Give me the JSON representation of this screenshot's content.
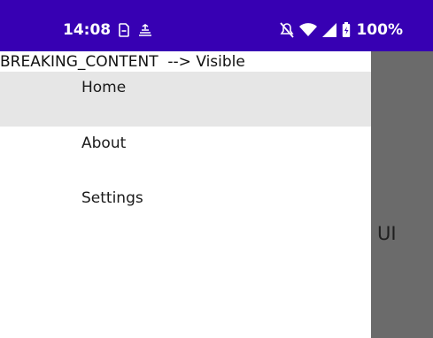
{
  "status_bar": {
    "time": "14:08",
    "battery": "100%",
    "left_icons": [
      "sim-card-icon",
      "data-saver-icon"
    ],
    "right_icons": [
      "notifications-off-icon",
      "wifi-icon",
      "signal-icon",
      "battery-icon"
    ],
    "background": "#3700b3"
  },
  "drawer": {
    "header_text": "BREAKING_CONTENT  --> Visible",
    "items": [
      {
        "label": "Home",
        "selected": true
      },
      {
        "label": "About",
        "selected": false
      },
      {
        "label": "Settings",
        "selected": false
      }
    ]
  },
  "content": {
    "label": "UI"
  }
}
